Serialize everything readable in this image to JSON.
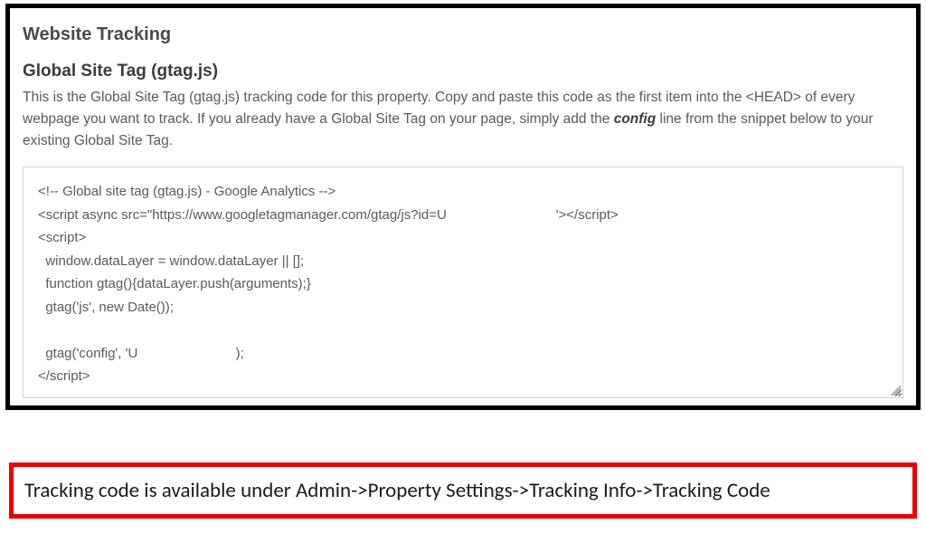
{
  "panel": {
    "section_title": "Website Tracking",
    "subsection_title": "Global Site Tag (gtag.js)",
    "description_before": "This is the Global Site Tag (gtag.js) tracking code for this property. Copy and paste this code as the first item into the <HEAD> of every webpage you want to track. If you already have a Global Site Tag on your page, simply add the ",
    "config_word": "config",
    "description_after": " line from the snippet below to your existing Global Site Tag.",
    "code": "<!-- Global site tag (gtag.js) - Google Analytics -->\n<script async src=\"https://www.googletagmanager.com/gtag/js?id=U                             '></script>\n<script>\n  window.dataLayer = window.dataLayer || [];\n  function gtag(){dataLayer.push(arguments);}\n  gtag('js', new Date());\n\n  gtag('config', 'U                          );\n</script>"
  },
  "note": {
    "text": "Tracking code is available under Admin->Property Settings->Tracking Info->Tracking Code"
  }
}
